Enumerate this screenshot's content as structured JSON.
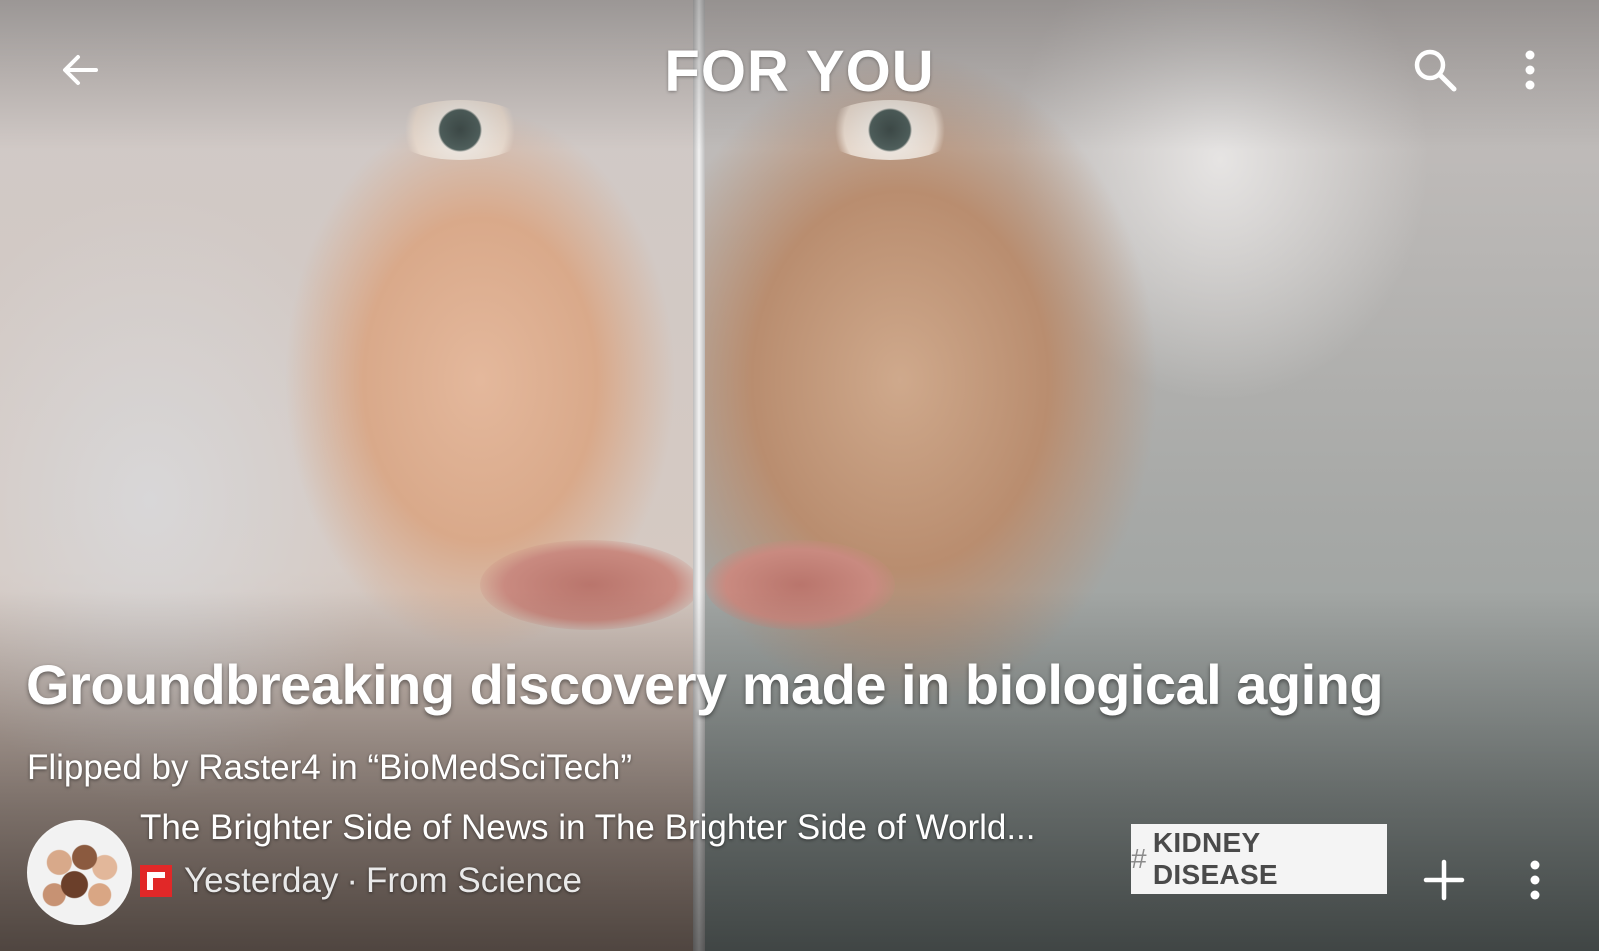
{
  "header": {
    "title": "FOR YOU",
    "back_icon": "arrow-left-icon",
    "search_icon": "search-icon",
    "menu_icon": "more-vertical-icon"
  },
  "article": {
    "headline": "Groundbreaking discovery made in biological aging",
    "flipped_prefix": "Flipped by Raster4 in “",
    "magazine": "BioMedSciTech",
    "flipped_suffix": "”",
    "source": "The Brighter Side of News in The Brighter Side of World...",
    "time": "Yesterday",
    "separator": "·",
    "from": "From Science",
    "tag": "KIDNEY DISEASE",
    "tag_hash": "#"
  },
  "actions": {
    "add_icon": "plus-icon",
    "more_icon": "more-vertical-icon"
  },
  "colors": {
    "flipboard_red": "#e12828",
    "tag_background": "#f4f4f4",
    "text": "#ffffff"
  }
}
